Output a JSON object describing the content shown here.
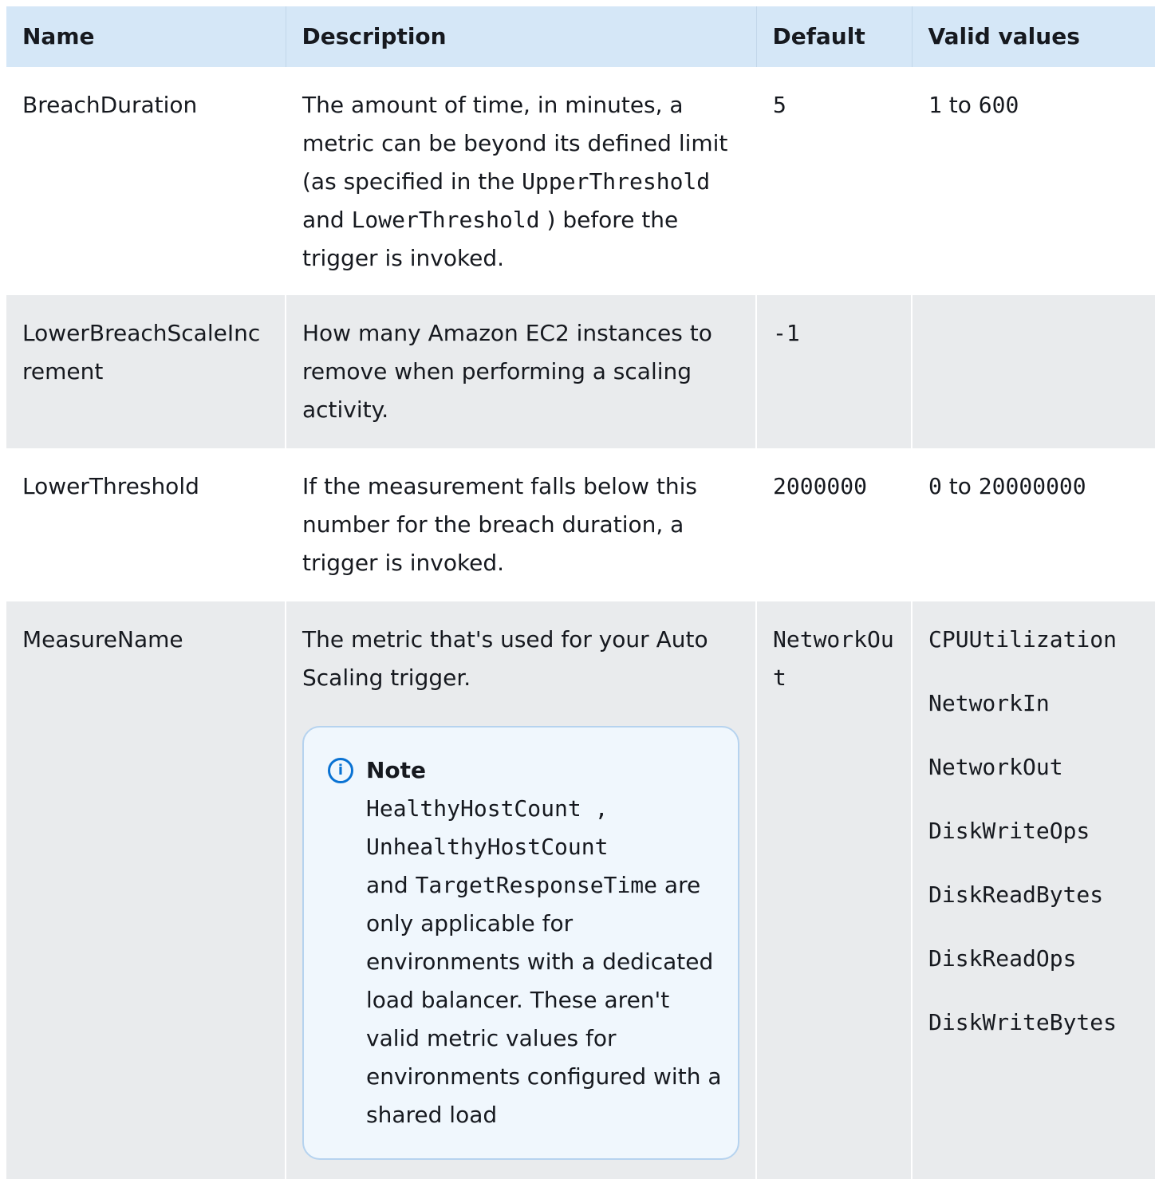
{
  "header": {
    "name": "Name",
    "description": "Description",
    "default": "Default",
    "valid_values": "Valid values"
  },
  "rows": [
    {
      "name": "BreachDuration",
      "desc_a": "The amount of time, in minutes, a metric can be beyond its defined limit (as specified in the ",
      "code_a": "UpperThreshold",
      "desc_b": " and ",
      "code_b": "LowerThreshold",
      "desc_c": " ) before the trigger is invoked.",
      "default": "5",
      "valid_from": "1",
      "valid_to_word": "to",
      "valid_to": "600"
    },
    {
      "name": "LowerBreachScaleIncrement",
      "desc": "How many Amazon EC2 instances to remove when performing a scaling activity.",
      "default": "-1"
    },
    {
      "name": "LowerThreshold",
      "desc": "If the measurement falls below this number for the breach duration, a trigger is invoked.",
      "default": "2000000",
      "valid_from": "0",
      "valid_to_word": "to",
      "valid_to": "20000000"
    },
    {
      "name": "MeasureName",
      "desc": "The metric that's used for your Auto Scaling trigger.",
      "default": "NetworkOut",
      "valid_values": [
        "CPUUtilization",
        "NetworkIn",
        "NetworkOut",
        "DiskWriteOps",
        "DiskReadBytes",
        "DiskReadOps",
        "DiskWriteBytes"
      ]
    }
  ],
  "note": {
    "icon": "info-icon",
    "title": "Note",
    "code_a": "HealthyHostCount",
    "sep_a": " ,",
    "code_b": "UnhealthyHostCount",
    "and_word": "and ",
    "code_c": "TargetResponseTime",
    "text": " are only applicable for environments with a dedicated load balancer. These aren't valid metric values for environments configured with a shared load"
  },
  "colors": {
    "header_bg": "#d5e7f7",
    "alt_row_bg": "#e9ebed",
    "note_bg": "#f0f7fd",
    "note_border": "#b6d3ef",
    "info_blue": "#0972d3"
  }
}
